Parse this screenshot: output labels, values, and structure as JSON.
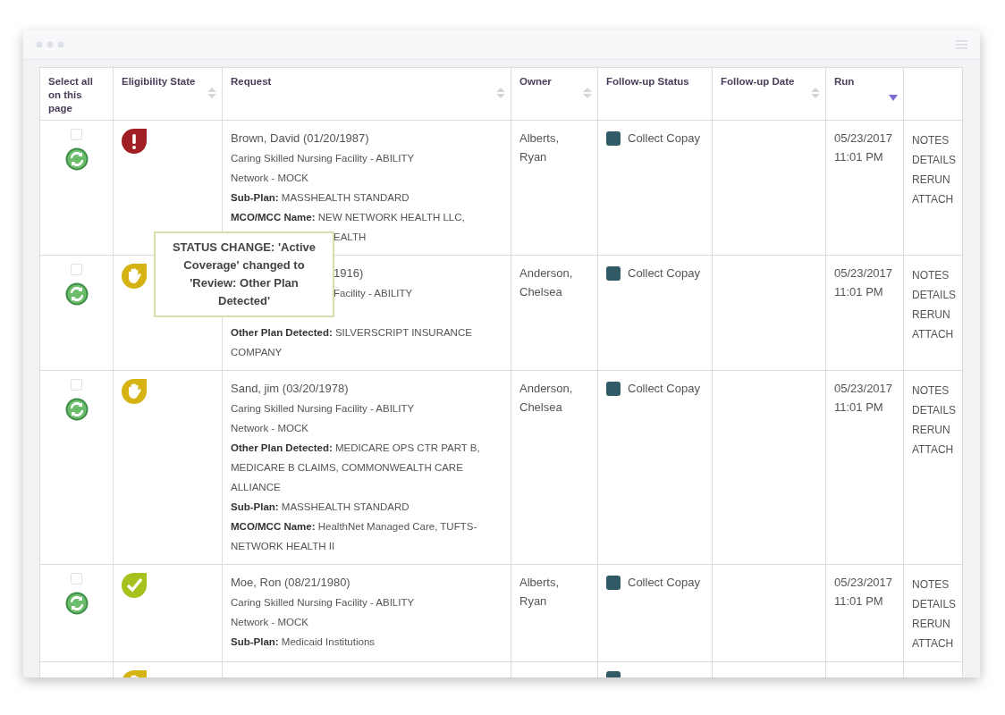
{
  "columns": [
    {
      "label": "Select all on this page",
      "sortable": false,
      "sorted": false
    },
    {
      "label": "Eligibility State",
      "sortable": true,
      "sorted": false
    },
    {
      "label": "Request",
      "sortable": true,
      "sorted": false
    },
    {
      "label": "Owner",
      "sortable": true,
      "sorted": false
    },
    {
      "label": "Follow-up Status",
      "sortable": false,
      "sorted": false
    },
    {
      "label": "Follow-up Date",
      "sortable": true,
      "sorted": false
    },
    {
      "label": "Run",
      "sortable": false,
      "sorted": true
    },
    {
      "sortable": false,
      "sorted": false
    }
  ],
  "rows": [
    {
      "checked": false,
      "eligibility": {
        "kind": "alert"
      },
      "name": {
        "text": "Brown, David (01/20/1987)"
      },
      "lines": [
        {
          "text": "Caring Skilled Nursing Facility - ABILITY"
        },
        {
          "text": "Network - MOCK"
        },
        {
          "label": "Sub-Plan:",
          "text": "MASSHEALTH STANDARD"
        },
        {
          "label": "MCO/MCC Name:",
          "text": "NEW NETWORK HEALTH LLC,"
        },
        {
          "text": "EALTH",
          "covered": true
        }
      ],
      "owner": "Alberts, Ryan",
      "status": {
        "label": "Collect Copay",
        "color": "#2f5a66"
      },
      "run": [
        "05/23/2017",
        "11:01 PM"
      ],
      "actions": [
        "NOTES",
        "DETAILS",
        "RERUN",
        "ATTACH"
      ]
    },
    {
      "checked": false,
      "eligibility": {
        "kind": "hold"
      },
      "name": {
        "text": "1916)",
        "covered": true
      },
      "lines": [
        {
          "text": "Facility - ABILITY",
          "covered": true
        },
        {
          "label": "Other Plan Detected:",
          "text": "SILVERSCRIPT INSURANCE COMPANY"
        }
      ],
      "owner": "Anderson, Chelsea",
      "status": {
        "label": "Collect Copay",
        "color": "#2f5a66"
      },
      "run": [
        "05/23/2017",
        "11:01 PM"
      ],
      "actions": [
        "NOTES",
        "DETAILS",
        "RERUN",
        "ATTACH"
      ]
    },
    {
      "checked": false,
      "eligibility": {
        "kind": "hold"
      },
      "name": {
        "text": "Sand, jim (03/20/1978)"
      },
      "lines": [
        {
          "text": "Caring Skilled Nursing Facility - ABILITY"
        },
        {
          "text": "Network - MOCK"
        },
        {
          "label": "Other Plan Detected:",
          "text": "MEDICARE OPS CTR PART B, MEDICARE B CLAIMS, COMMONWEALTH CARE ALLIANCE"
        },
        {
          "label": "Sub-Plan:",
          "text": "MASSHEALTH STANDARD"
        },
        {
          "label": "MCO/MCC Name:",
          "text": "HealthNet Managed Care, TUFTS-NETWORK HEALTH II"
        }
      ],
      "owner": "Anderson, Chelsea",
      "status": {
        "label": "Collect Copay",
        "color": "#2f5a66"
      },
      "run": [
        "05/23/2017",
        "11:01 PM"
      ],
      "actions": [
        "NOTES",
        "DETAILS",
        "RERUN",
        "ATTACH"
      ]
    },
    {
      "checked": false,
      "eligibility": {
        "kind": "ok"
      },
      "name": {
        "text": "Moe, Ron (08/21/1980)"
      },
      "lines": [
        {
          "text": "Caring Skilled Nursing Facility - ABILITY"
        },
        {
          "text": "Network - MOCK"
        },
        {
          "label": "Sub-Plan:",
          "text": "Medicaid Institutions"
        }
      ],
      "owner": "Alberts, Ryan",
      "status": {
        "label": "Collect Copay",
        "color": "#2f5a66"
      },
      "run": [
        "05/23/2017",
        "11:01 PM"
      ],
      "actions": [
        "NOTES",
        "DETAILS",
        "RERUN",
        "ATTACH"
      ]
    },
    {
      "eligibility": {
        "kind": "hold"
      },
      "status": {
        "color": "#2f5a66"
      }
    }
  ],
  "tooltip": {
    "text": "STATUS CHANGE: 'Active Coverage' changed to 'Review: Other Plan Detected'"
  }
}
